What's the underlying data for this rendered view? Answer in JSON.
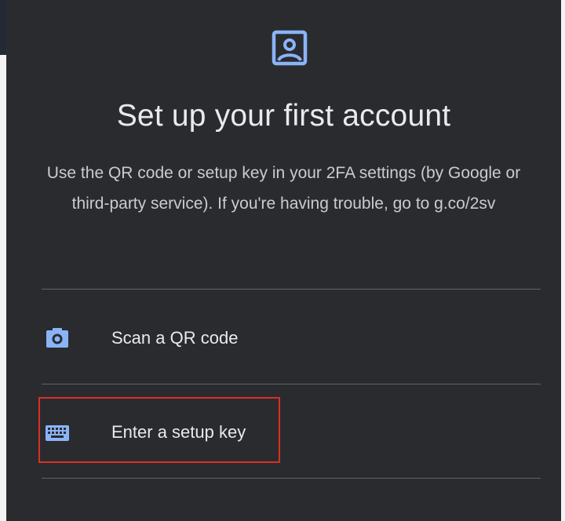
{
  "screen": {
    "title": "Set up your first account",
    "description": "Use the QR code or setup key in your 2FA settings (by Google or third-party service). If you're having trouble, go to g.co/2sv"
  },
  "options": [
    {
      "label": "Scan a QR code",
      "icon": "camera-icon"
    },
    {
      "label": "Enter a setup key",
      "icon": "keyboard-icon"
    }
  ],
  "header_icon": "account-portrait-icon",
  "colors": {
    "background": "#2a2b2f",
    "text": "#e8eaed",
    "accent": "#8ab4f8",
    "divider": "#5f6368",
    "highlight": "#d93025"
  }
}
